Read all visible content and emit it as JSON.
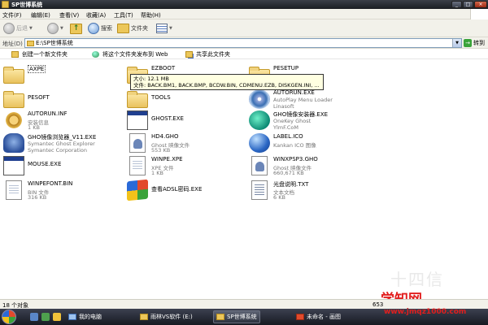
{
  "window": {
    "title": "SP世博系统",
    "min": "_",
    "max": "□",
    "close": "×"
  },
  "menu": [
    "文件(F)",
    "编辑(E)",
    "查看(V)",
    "收藏(A)",
    "工具(T)",
    "帮助(H)"
  ],
  "toolbar": {
    "back": "后退",
    "search": "搜索",
    "folders": "文件夹"
  },
  "address": {
    "label": "地址(D)",
    "path": "E:\\SP世博系统",
    "go": "转到"
  },
  "tasks": {
    "new_folder": "创建一个新文件夹",
    "publish": "将这个文件夹发布到 Web",
    "share": "共享此文件夹"
  },
  "files": [
    {
      "name": "AXPE",
      "icon": "folder-icon",
      "l1": "",
      "l2": ""
    },
    {
      "name": "EZBOOT",
      "icon": "folder-icon",
      "l1": "",
      "l2": ""
    },
    {
      "name": "PESETUP",
      "icon": "folder-icon",
      "l1": "",
      "l2": ""
    },
    {
      "name": "PESOFT",
      "icon": "folder-icon",
      "l1": "",
      "l2": ""
    },
    {
      "name": "TOOLS",
      "icon": "folder-icon",
      "l1": "",
      "l2": ""
    },
    {
      "name": "AUTORUN.EXE",
      "icon": "autoplay-disc-icon",
      "l1": "AutoPlay Menu Loader",
      "l2": "Linasoft"
    },
    {
      "name": "AUTORUN.INF",
      "icon": "settings-file-icon",
      "l1": "安装信息",
      "l2": "1 KB"
    },
    {
      "name": "GHOST.EXE",
      "icon": "program-window-icon",
      "l1": "",
      "l2": ""
    },
    {
      "name": "GHO镜像安装器.EXE",
      "icon": "onekey-ghost-icon",
      "l1": "OneKey Ghost",
      "l2": "YlmF.CoM"
    },
    {
      "name": "GHO镜像浏览器_V11.EXE",
      "icon": "ghost-explorer-icon",
      "l1": "Symantec Ghost Explorer",
      "l2": "Symantec Corporation"
    },
    {
      "name": "HD4.GHO",
      "icon": "ghost-image-icon",
      "l1": "Ghost 映像文件",
      "l2": "553 KB"
    },
    {
      "name": "LABEL.ICO",
      "icon": "globe-icon",
      "l1": "Kankan ICO 图像",
      "l2": ""
    },
    {
      "name": "MOUSE.EXE",
      "icon": "program-window-icon",
      "l1": "",
      "l2": ""
    },
    {
      "name": "WINPE.XPE",
      "icon": "document-icon",
      "l1": "XPE 文件",
      "l2": "1 KB"
    },
    {
      "name": "WINXPSP3.GHO",
      "icon": "ghost-image-icon",
      "l1": "Ghost 映像文件",
      "l2": "660,671 KB"
    },
    {
      "name": "WINPEFONT.BIN",
      "icon": "document-icon",
      "l1": "BIN 文件",
      "l2": "316 KB"
    },
    {
      "name": "查看ADSL密码.EXE",
      "icon": "windows-logo-icon",
      "l1": "",
      "l2": ""
    },
    {
      "name": "光盘说明.TXT",
      "icon": "text-file-icon",
      "l1": "文本文档",
      "l2": "6 KB"
    }
  ],
  "tooltip": {
    "line1": "大小: 12.1 MB",
    "line2": "文件: BACK.BM1, BACK.BMP, BCDW.BIN, CDMENU.EZB, DISKGEN.INI, ..."
  },
  "status": {
    "left": "18 个对象",
    "right": "653"
  },
  "taskbar": {
    "item1": "我的电脑",
    "item2": "雨林VS软件 (E:)",
    "item3": "SP世博系统",
    "item4": "未命名 - 画图"
  },
  "watermark": {
    "site": "学知网",
    "url": "www.jmqz1000.com",
    "faint": "十四信"
  },
  "colors": {
    "titlebar": "#1a1d22",
    "watermark": "#e21e1e",
    "tooltip_bg": "#ffffe1"
  }
}
